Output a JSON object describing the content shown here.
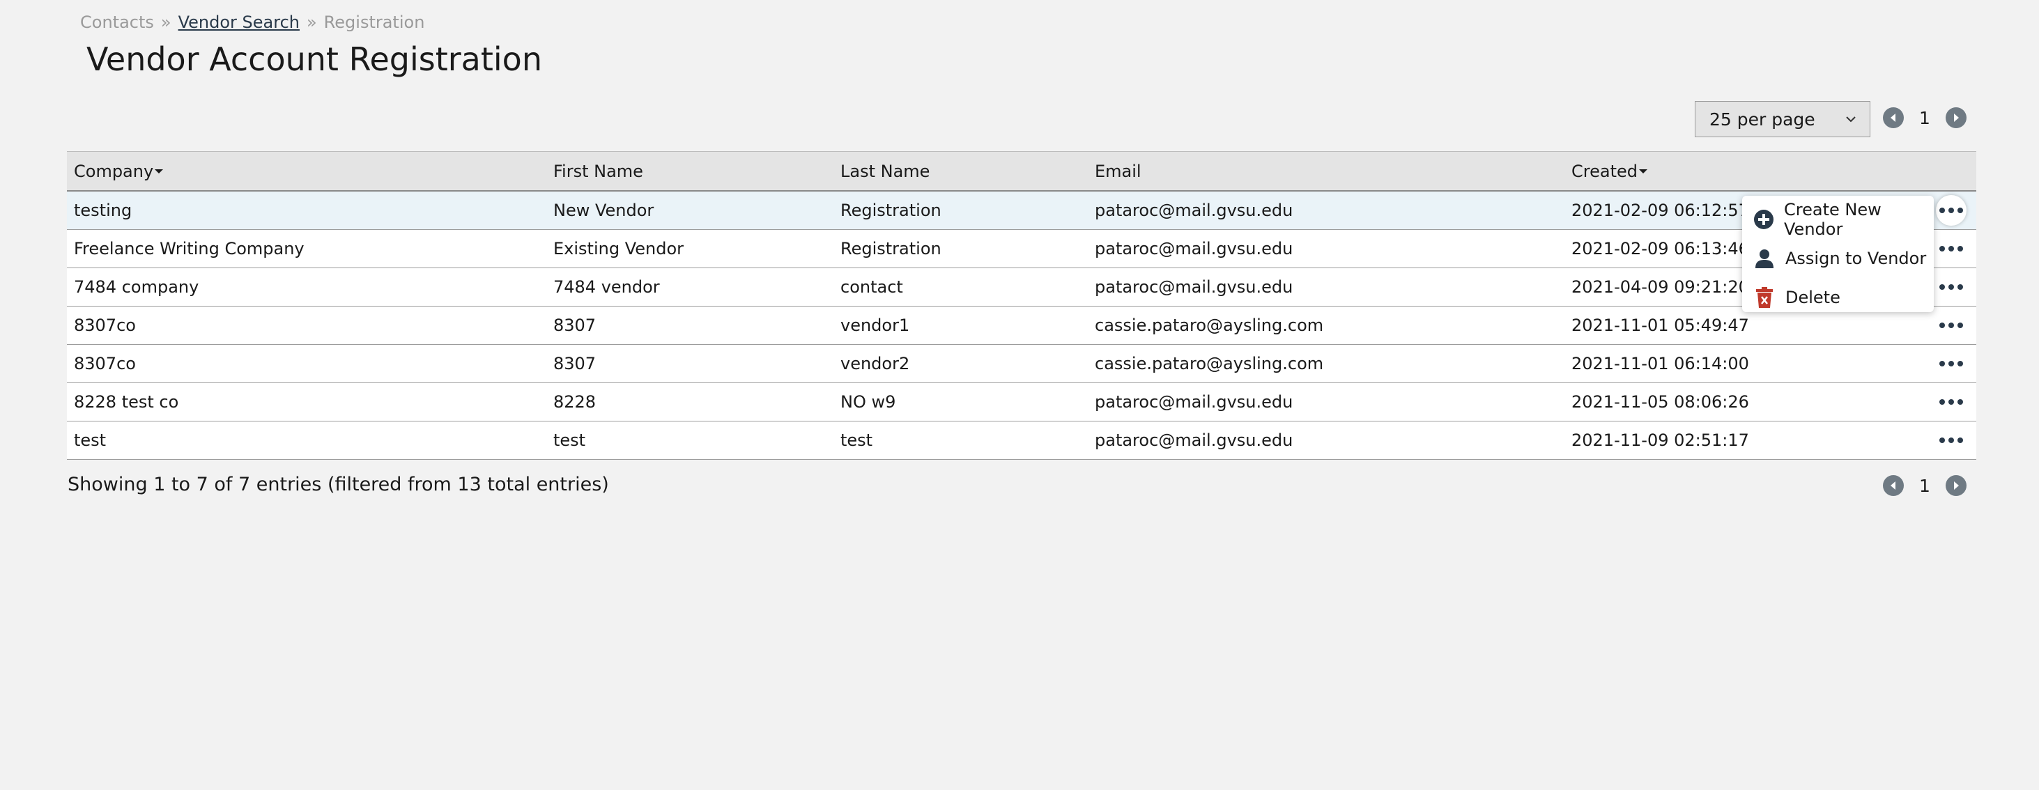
{
  "breadcrumb": {
    "items": [
      "Contacts",
      "Vendor Search",
      "Registration"
    ],
    "separator": "»"
  },
  "page_title": "Vendor Account Registration",
  "per_page": {
    "selected": "25 per page"
  },
  "pagination": {
    "current_page": "1"
  },
  "table": {
    "headers": {
      "company": "Company",
      "first_name": "First Name",
      "last_name": "Last Name",
      "email": "Email",
      "created": "Created"
    },
    "rows": [
      {
        "company": "testing",
        "first_name": "New Vendor",
        "last_name": "Registration",
        "email": "pataroc@mail.gvsu.edu",
        "created": "2021-02-09 06:12:57"
      },
      {
        "company": "Freelance Writing Company",
        "first_name": "Existing Vendor",
        "last_name": "Registration",
        "email": "pataroc@mail.gvsu.edu",
        "created": "2021-02-09 06:13:46"
      },
      {
        "company": "7484 company",
        "first_name": "7484 vendor",
        "last_name": "contact",
        "email": "pataroc@mail.gvsu.edu",
        "created": "2021-04-09 09:21:20"
      },
      {
        "company": "8307co",
        "first_name": "8307",
        "last_name": "vendor1",
        "email": "cassie.pataro@aysling.com",
        "created": "2021-11-01 05:49:47"
      },
      {
        "company": "8307co",
        "first_name": "8307",
        "last_name": "vendor2",
        "email": "cassie.pataro@aysling.com",
        "created": "2021-11-01 06:14:00"
      },
      {
        "company": "8228 test co",
        "first_name": "8228",
        "last_name": "NO w9",
        "email": "pataroc@mail.gvsu.edu",
        "created": "2021-11-05 08:06:26"
      },
      {
        "company": "test",
        "first_name": "test",
        "last_name": "test",
        "email": "pataroc@mail.gvsu.edu",
        "created": "2021-11-09 02:51:17"
      }
    ]
  },
  "summary": "Showing 1 to 7 of 7 entries (filtered from 13 total entries)",
  "context_menu": {
    "items": [
      {
        "label": "Create New Vendor",
        "icon": "plus-circle-icon"
      },
      {
        "label": "Assign to Vendor",
        "icon": "user-icon"
      },
      {
        "label": "Delete",
        "icon": "trash-icon"
      }
    ]
  },
  "colors": {
    "background": "#f2f2f2",
    "header_bg": "#e4e4e4",
    "highlight_row": "#eaf3f8",
    "pager_button": "#6f7a83",
    "icon_dark": "#2a3a4a",
    "delete_red": "#c0392b"
  }
}
